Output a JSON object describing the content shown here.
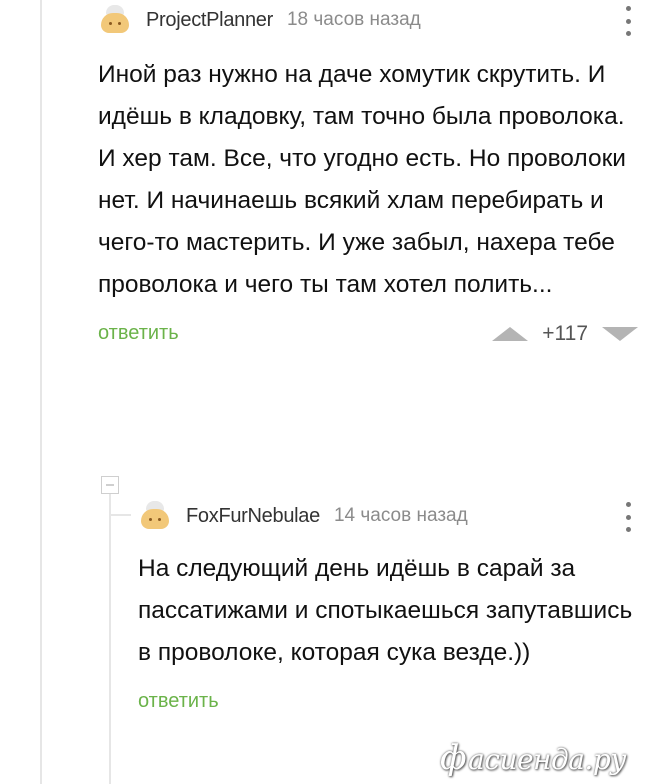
{
  "comments": [
    {
      "author": "ProjectPlanner",
      "time": "18 часов назад",
      "text": "Иной раз нужно на даче хомутик скрутить. И идёшь в кладовку, там точно была проволока. И хер там. Все, что угодно есть. Но проволоки нет. И начинаешь всякий хлам перебирать и чего-то мастерить. И уже забыл, нахера тебе проволока и чего ты там хотел полить...",
      "reply_label": "ответить",
      "rating": "+117"
    },
    {
      "author": "FoxFurNebulae",
      "time": "14 часов назад",
      "text": "На следующий день идёшь в сарай за пассатижами и спотыкаешься запутавшись в проволоке, которая сука везде.))",
      "reply_label": "ответить"
    }
  ],
  "watermark": {
    "symbol": "ф",
    "text": "асиенда.ру"
  }
}
